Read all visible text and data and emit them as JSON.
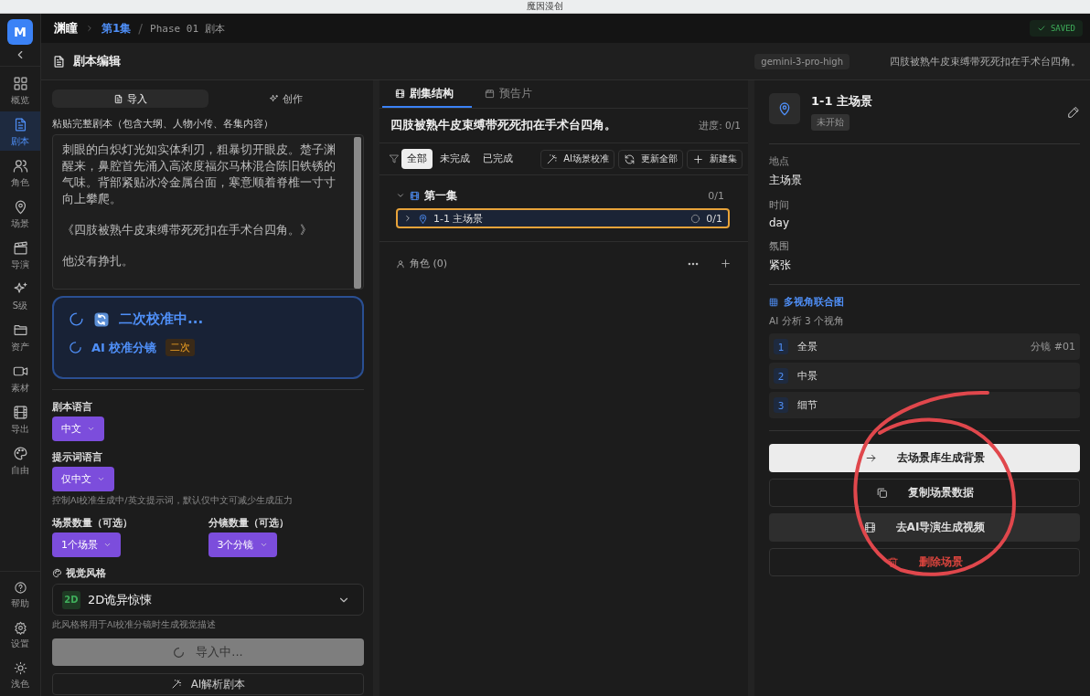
{
  "window": {
    "title": "魔因漫创"
  },
  "nav": {
    "logo": "M",
    "items": [
      {
        "label": "概览",
        "selected": false
      },
      {
        "label": "剧本",
        "selected": true
      },
      {
        "label": "角色",
        "selected": false
      },
      {
        "label": "场景",
        "selected": false
      },
      {
        "label": "导演",
        "selected": false
      },
      {
        "label": "S级",
        "selected": false
      },
      {
        "label": "资产",
        "selected": false
      },
      {
        "label": "素材",
        "selected": false
      },
      {
        "label": "导出",
        "selected": false
      },
      {
        "label": "自由",
        "selected": false
      }
    ],
    "bottom_items": [
      {
        "label": "帮助"
      },
      {
        "label": "设置"
      },
      {
        "label": "浅色"
      }
    ]
  },
  "breadcrumb": {
    "project": "渊瞳",
    "episode": "第1集",
    "separator": "/",
    "phase": "Phase 01 剧本"
  },
  "saved": "SAVED",
  "editor": {
    "title": "剧本编辑",
    "model": "gemini-3-pro-high",
    "summary": "四肢被熟牛皮束缚带死死扣在手术台四角。"
  },
  "left": {
    "tabs": [
      {
        "label": "导入",
        "selected": true
      },
      {
        "label": "创作",
        "selected": false
      }
    ],
    "paste_label": "粘贴完整剧本（包含大纲、人物小传、各集内容）",
    "script_paragraphs": [
      "刺眼的白炽灯光如实体利刃，粗暴切开眼皮。楚子渊醒来，鼻腔首先涌入高浓度福尔马林混合陈旧铁锈的气味。背部紧贴冰冷金属台面，寒意顺着脊椎一寸寸向上攀爬。",
      "《四肢被熟牛皮束缚带死死扣在手术台四角。》",
      "他没有挣扎。"
    ],
    "progress": {
      "title": "二次校准中...",
      "step": "AI 校准分镜",
      "step_badge": "二次"
    },
    "script_language": {
      "label": "剧本语言",
      "value": "中文"
    },
    "prompt_language": {
      "label": "提示词语言",
      "value": "仅中文",
      "hint": "控制AI校准生成中/英文提示词，默认仅中文可减少生成压力"
    },
    "scene_count": {
      "label": "场景数量（可选）",
      "value": "1个场景"
    },
    "shot_count": {
      "label": "分镜数量（可选）",
      "value": "3个分镜"
    },
    "style": {
      "label": "视觉风格",
      "badge": "2D",
      "value": "2D诡异惊悚",
      "hint": "此风格将用于AI校准分镜时生成视觉描述"
    },
    "import_button": {
      "label": "导入中...",
      "disabled": true
    },
    "parse_button": {
      "label": "AI解析剧本"
    }
  },
  "middle": {
    "tabs": [
      {
        "label": "剧集结构",
        "selected": true
      },
      {
        "label": "预告片",
        "selected": false
      }
    ],
    "heading": "四肢被熟牛皮束缚带死死扣在手术台四角。",
    "progress": "进度: 0/1",
    "filters": [
      {
        "label": "全部",
        "selected": true
      },
      {
        "label": "未完成",
        "selected": false
      },
      {
        "label": "已完成",
        "selected": false
      }
    ],
    "actions": [
      {
        "label": "AI场景校准"
      },
      {
        "label": "更新全部"
      },
      {
        "label": "新建集"
      }
    ],
    "episodes": [
      {
        "title": "第一集",
        "count": "0/1",
        "expanded": true,
        "scenes": [
          {
            "title": "1-1 主场景",
            "count": "0/1",
            "selected": true
          }
        ]
      }
    ],
    "characters": "角色 (0)"
  },
  "right": {
    "title": "1-1 主场景",
    "status": "未开始",
    "fields": [
      {
        "label": "地点",
        "value": "主场景"
      },
      {
        "label": "时间",
        "value": "day"
      },
      {
        "label": "氛围",
        "value": "紧张"
      }
    ],
    "views_title": "多视角联合图",
    "views_subtitle": "AI 分析 3 个视角",
    "views": [
      {
        "number": "1",
        "label": "全景",
        "shot": "分镜 #01"
      },
      {
        "number": "2",
        "label": "中景"
      },
      {
        "number": "3",
        "label": "细节"
      }
    ],
    "actions": [
      {
        "label": "去场景库生成背景",
        "kind": "primary"
      },
      {
        "label": "复制场景数据",
        "kind": "outline"
      },
      {
        "label": "去AI导演生成视频",
        "kind": "filled"
      },
      {
        "label": "删除场景",
        "kind": "danger"
      }
    ]
  }
}
